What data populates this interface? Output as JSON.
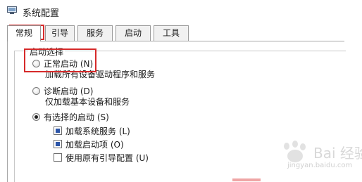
{
  "window": {
    "title": "系统配置"
  },
  "tabs": [
    {
      "label": "常规",
      "active": true
    },
    {
      "label": "引导",
      "active": false
    },
    {
      "label": "服务",
      "active": false
    },
    {
      "label": "启动",
      "active": false
    },
    {
      "label": "工具",
      "active": false
    }
  ],
  "startup": {
    "group_label": "启动选择",
    "options": [
      {
        "label": "正常启动 (N)",
        "description": "加载所有设备驱动程序和服务",
        "checked": false
      },
      {
        "label": "诊断启动 (D)",
        "description": "仅加载基本设备和服务",
        "checked": false
      },
      {
        "label": "有选择的启动 (S)",
        "checked": true
      }
    ],
    "selective_items": [
      {
        "label": "加载系统服务 (L)",
        "checked": true
      },
      {
        "label": "加载启动项 (O)",
        "checked": true
      },
      {
        "label": "使用原有引导配置 (U)",
        "checked": false
      }
    ]
  },
  "watermark": {
    "text": "Bai 经验",
    "url": "jingyan.baidu.com"
  },
  "colors": {
    "highlight": "#d62a2a",
    "checkbox_fill": "#2c55a8"
  }
}
